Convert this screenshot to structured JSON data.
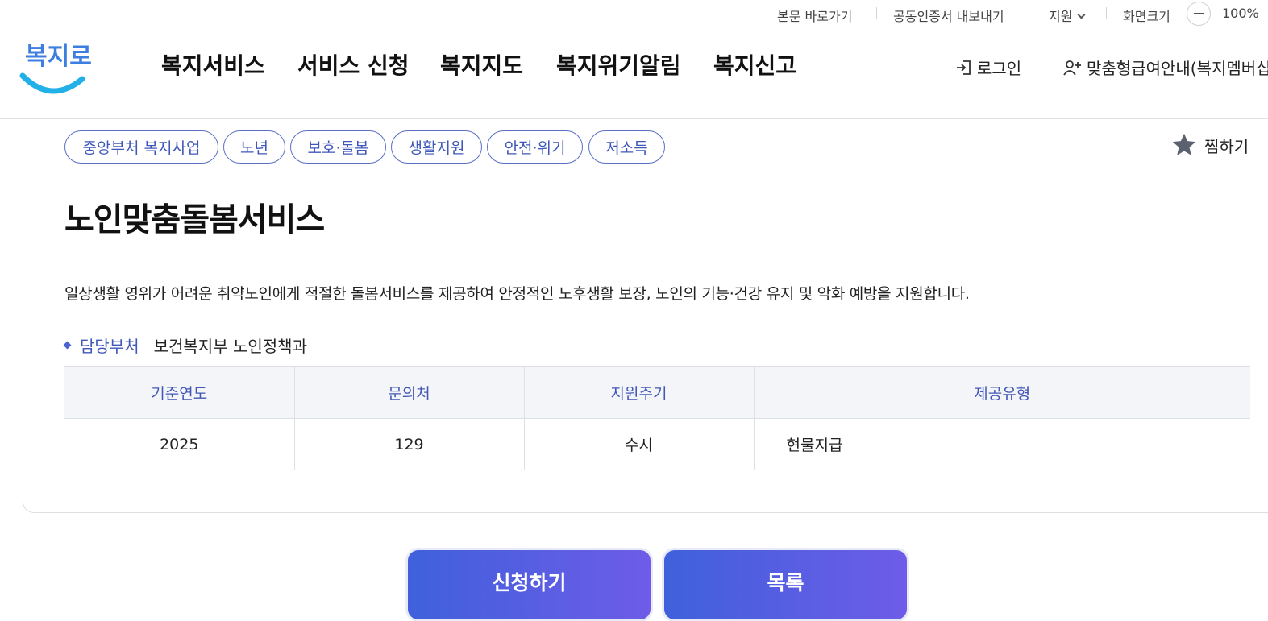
{
  "utility": {
    "skip_to_content": "본문 바로가기",
    "cert_export": "공동인증서 내보내기",
    "support": "지원",
    "font_size": "화면크기",
    "zoom_level": "100%"
  },
  "logo": {
    "text": "복지로"
  },
  "gnb": [
    "복지서비스",
    "서비스 신청",
    "복지지도",
    "복지위기알림",
    "복지신고"
  ],
  "header_links": {
    "login": "로그인",
    "custom_guide": "맞춤형급여안내(복지멤버십)"
  },
  "tags": [
    "중앙부처 복지사업",
    "노년",
    "보호·돌봄",
    "생활지원",
    "안전·위기",
    "저소득"
  ],
  "favorite": {
    "label": "찜하기"
  },
  "service": {
    "title": "노인맞춤돌봄서비스",
    "description": "일상생활 영위가 어려운 취약노인에게 적절한 돌봄서비스를 제공하여 안정적인 노후생활 보장, 노인의 기능·건강 유지 및 악화 예방을 지원합니다.",
    "dept_label": "담당부처",
    "dept_value": "보건복지부 노인정책과"
  },
  "info_table": {
    "headers": [
      "기준연도",
      "문의처",
      "지원주기",
      "제공유형"
    ],
    "row": [
      "2025",
      "129",
      "수시",
      "현물지급"
    ]
  },
  "buttons": {
    "apply": "신청하기",
    "list": "목록"
  },
  "colors": {
    "primary": "#3f57b8",
    "button_start": "#3f60dc",
    "button_end": "#6e5ce8",
    "logo": "#3d7fe0"
  }
}
